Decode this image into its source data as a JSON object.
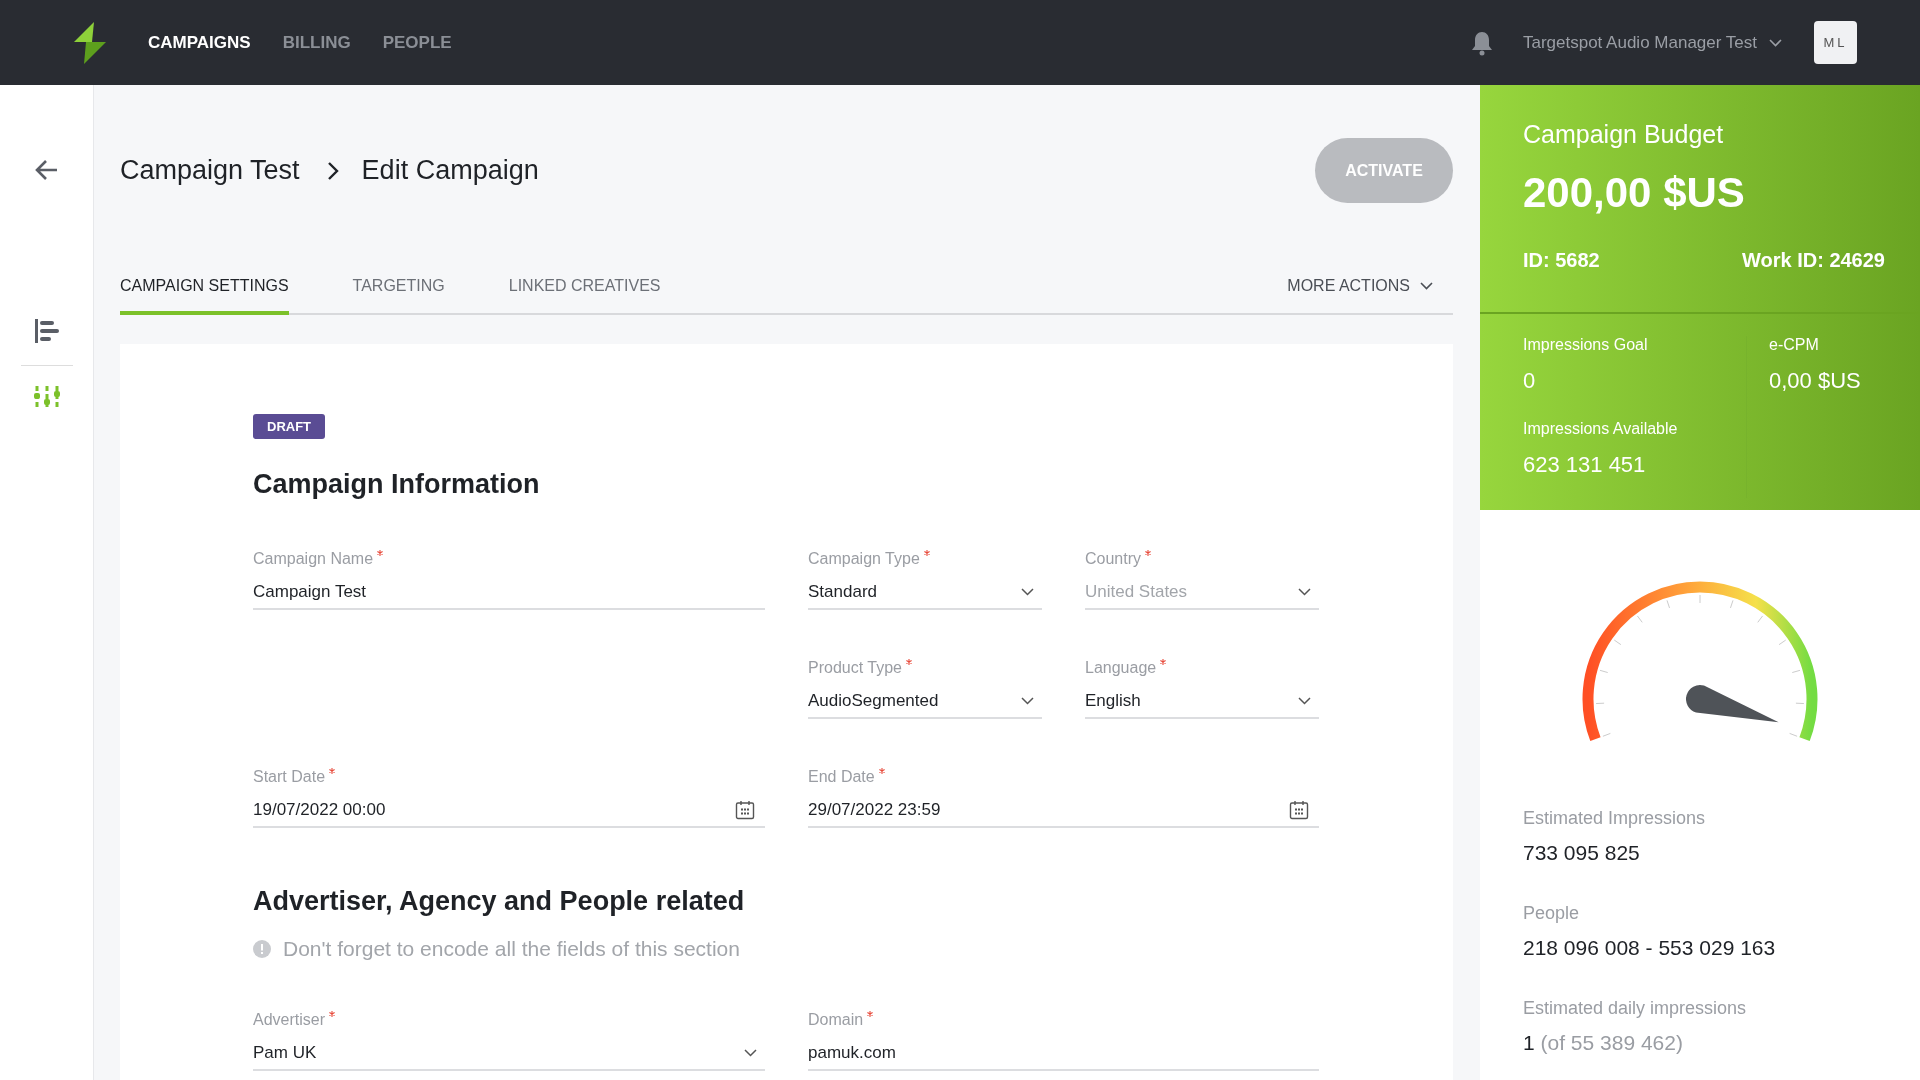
{
  "topbar": {
    "nav": [
      {
        "label": "CAMPAIGNS",
        "selected": true
      },
      {
        "label": "BILLING",
        "selected": false
      },
      {
        "label": "PEOPLE",
        "selected": false
      }
    ],
    "account": "Targetspot Audio Manager Test",
    "avatar": "ML"
  },
  "sidebar": {
    "items": [
      {
        "kind": "list",
        "selected": false
      },
      {
        "kind": "sliders",
        "selected": true
      }
    ]
  },
  "header": {
    "breadcrumb": [
      "Campaign Test",
      "Edit Campaign"
    ],
    "activate": {
      "label": "ACTIVATE",
      "disabled": true
    }
  },
  "tabs": [
    {
      "label": "CAMPAIGN SETTINGS",
      "selected": true
    },
    {
      "label": "TARGETING",
      "selected": false
    },
    {
      "label": "LINKED CREATIVES",
      "selected": false
    }
  ],
  "more_actions": "MORE ACTIONS",
  "status_badge": "DRAFT",
  "sections": [
    {
      "title": "Campaign Information",
      "rows": [
        [
          {
            "label": "Campaign Name",
            "required": true,
            "kind": "text",
            "value": "Campaign Test"
          },
          {
            "label": "Campaign Type",
            "required": true,
            "kind": "select",
            "value": "Standard"
          },
          {
            "label": "Country",
            "required": true,
            "kind": "select",
            "placeholder": "United States"
          }
        ],
        [
          null,
          {
            "label": "Product Type",
            "required": true,
            "kind": "select",
            "value": "AudioSegmented"
          },
          {
            "label": "Language",
            "required": true,
            "kind": "select",
            "value": "English"
          }
        ],
        [
          {
            "label": "Start Date",
            "required": true,
            "kind": "date",
            "value": "19/07/2022 00:00"
          },
          {
            "label": "End Date",
            "required": true,
            "kind": "date",
            "value": "29/07/2022 23:59"
          }
        ]
      ]
    },
    {
      "title": "Advertiser, Agency and People related",
      "note": "Don't forget to encode all the fields of this section",
      "rows": [
        [
          {
            "label": "Advertiser",
            "required": true,
            "kind": "select",
            "value": "Pam UK"
          },
          {
            "label": "Domain",
            "required": true,
            "kind": "text",
            "value": "pamuk.com"
          }
        ]
      ]
    }
  ],
  "budget": {
    "title": "Campaign Budget",
    "amount": "200,00 $US",
    "id_label": "ID:",
    "id": "5682",
    "work_id_label": "Work ID:",
    "work_id": "24629",
    "stats": [
      {
        "label": "Impressions Goal",
        "value": "0"
      },
      {
        "label": "Impressions Available",
        "value": "623 131 451"
      },
      {
        "label": "e-CPM",
        "value": "0,00 $US"
      }
    ]
  },
  "estimates": [
    {
      "label": "Estimated Impressions",
      "value": "733 095 825"
    },
    {
      "label": "People",
      "value": "218 096 008 - 553 029 163"
    },
    {
      "label": "Estimated daily impressions",
      "value": "1",
      "total": "(of 55 389 462)"
    }
  ]
}
